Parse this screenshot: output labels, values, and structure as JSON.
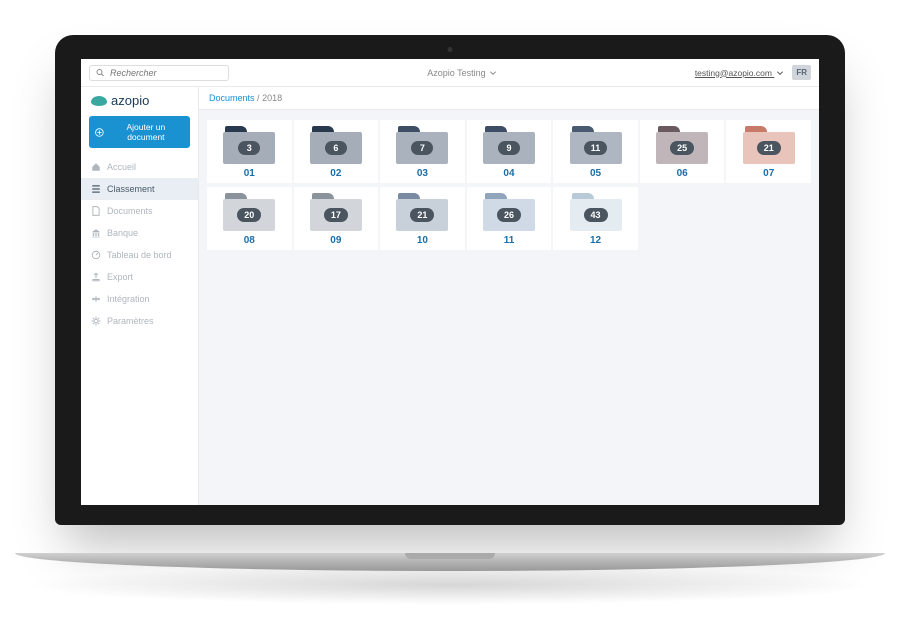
{
  "brand": {
    "name": "azopio"
  },
  "topbar": {
    "search_placeholder": "Rechercher",
    "tenant": "Azopio Testing",
    "user_email": "testing@azopio.com",
    "lang": "FR"
  },
  "sidebar": {
    "add_label": "Ajouter un document",
    "items": [
      {
        "label": "Accueil",
        "icon": "home",
        "active": false
      },
      {
        "label": "Classement",
        "icon": "list",
        "active": true
      },
      {
        "label": "Documents",
        "icon": "file",
        "active": false
      },
      {
        "label": "Banque",
        "icon": "bank",
        "active": false
      },
      {
        "label": "Tableau de bord",
        "icon": "gauge",
        "active": false
      },
      {
        "label": "Export",
        "icon": "export",
        "active": false
      },
      {
        "label": "Intégration",
        "icon": "integration",
        "active": false
      },
      {
        "label": "Paramètres",
        "icon": "gear",
        "active": false
      }
    ]
  },
  "breadcrumb": {
    "root": "Documents",
    "current": "2018",
    "sep": "/"
  },
  "folders": [
    {
      "label": "01",
      "count": "3",
      "tab": "#2a3a4e",
      "body": "#a5aeb8"
    },
    {
      "label": "02",
      "count": "6",
      "tab": "#2a3a4e",
      "body": "#a5aeb8"
    },
    {
      "label": "03",
      "count": "7",
      "tab": "#3d4d63",
      "body": "#a9b2bd"
    },
    {
      "label": "04",
      "count": "9",
      "tab": "#3d4d63",
      "body": "#a9b2bd"
    },
    {
      "label": "05",
      "count": "11",
      "tab": "#4a5a70",
      "body": "#adb6c1"
    },
    {
      "label": "06",
      "count": "25",
      "tab": "#6a5a60",
      "body": "#c0b6ba"
    },
    {
      "label": "07",
      "count": "21",
      "tab": "#c77a68",
      "body": "#e8c4ba"
    },
    {
      "label": "08",
      "count": "20",
      "tab": "#8a929c",
      "body": "#d2d6db"
    },
    {
      "label": "09",
      "count": "17",
      "tab": "#8a929c",
      "body": "#d2d6db"
    },
    {
      "label": "10",
      "count": "21",
      "tab": "#7a8aa0",
      "body": "#c8d0da"
    },
    {
      "label": "11",
      "count": "26",
      "tab": "#90a4bc",
      "body": "#d0dae6"
    },
    {
      "label": "12",
      "count": "43",
      "tab": "#b8cad8",
      "body": "#e4ecf2"
    }
  ]
}
